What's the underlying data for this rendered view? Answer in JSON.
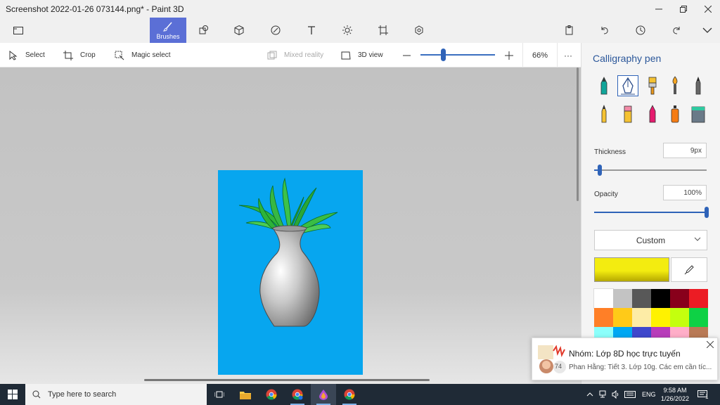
{
  "window": {
    "title": "Screenshot 2022-01-26 073144.png* - Paint 3D",
    "minimize_icon": "minimize-icon",
    "maximize_icon": "restore-icon",
    "close_icon": "close-icon"
  },
  "ribbon": {
    "brushes_label": "Brushes"
  },
  "toolbar": {
    "select_label": "Select",
    "crop_label": "Crop",
    "magic_select_label": "Magic select",
    "mixed_reality_label": "Mixed reality",
    "view3d_label": "3D view",
    "zoom_level": "66%",
    "zoom_fraction": 0.3,
    "more_label": "···"
  },
  "panel": {
    "title": "Calligraphy pen",
    "thickness_label": "Thickness",
    "thickness_value": "9px",
    "thickness_fraction": 0.05,
    "opacity_label": "Opacity",
    "opacity_value": "100%",
    "opacity_fraction": 1.0,
    "color_mode": "Custom",
    "current_color": "#f3ec10",
    "swatches": [
      "#ffffff",
      "#c3c3c3",
      "#585858",
      "#000000",
      "#88001b",
      "#ec1c24",
      "#ff7f27",
      "#ffca18",
      "#fdeca6",
      "#fff200",
      "#c4ff0e",
      "#0ed145",
      "#8cfffb",
      "#00a8f3",
      "#3f48cc",
      "#b83dba",
      "#ffaec8",
      "#b97a56"
    ]
  },
  "canvas": {
    "background_color": "#07a6ef"
  },
  "notification": {
    "title": "Nhóm: Lớp 8D học trực tuyến",
    "message": "Phan Hằng: Tiết 3. Lớp 10g. Các em cần tíc...",
    "badge": "74"
  },
  "taskbar": {
    "search_placeholder": "Type here to search",
    "language": "ENG",
    "time": "9:58 AM",
    "date": "1/26/2022",
    "notification_count": "1"
  }
}
